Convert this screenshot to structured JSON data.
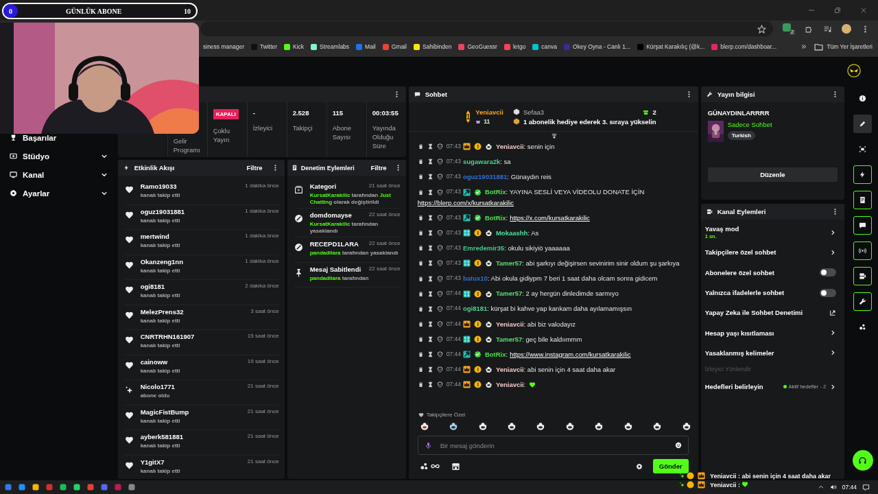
{
  "goal_overlay": {
    "current": "0",
    "label": "GÜNLÜK ABONE",
    "target": "10"
  },
  "browser": {
    "extension_badge": "2",
    "bookmarks": [
      {
        "label": "siness manager"
      },
      {
        "label": "Twitter",
        "color": "#111111"
      },
      {
        "label": "Kick",
        "color": "#53fc18"
      },
      {
        "label": "Streamlabs",
        "color": "#80f5d2"
      },
      {
        "label": "Mail",
        "color": "#1a73e8"
      },
      {
        "label": "Gmail",
        "color": "#ea4335"
      },
      {
        "label": "Sahibinden",
        "color": "#ffe800"
      },
      {
        "label": "GeoGuessr",
        "color": "#e94560"
      },
      {
        "label": "letgo",
        "color": "#ff3f55"
      },
      {
        "label": "canva",
        "color": "#00c4cc"
      },
      {
        "label": "Okey Oyna - Canlı 1...",
        "color": "#3b2b8f"
      },
      {
        "label": "Kürşat Karakılıç (@k...",
        "color": "#000000"
      },
      {
        "label": "blerp.com/dashboar...",
        "color": "#e8265e"
      }
    ],
    "all_bookmarks": "Tüm Yer İşaretleri"
  },
  "sidebar": [
    {
      "label": "Başarılar",
      "expandable": false
    },
    {
      "label": "Stüdyo",
      "expandable": true
    },
    {
      "label": "Kanal",
      "expandable": true
    },
    {
      "label": "Ayarlar",
      "expandable": true
    }
  ],
  "stats": [
    {
      "kind": "text",
      "label": "Gelir Programı"
    },
    {
      "kind": "badge",
      "value": "KAPALI",
      "label": "Çoklu Yayın"
    },
    {
      "kind": "text",
      "value": "-",
      "label": "İzleyici"
    },
    {
      "kind": "text",
      "value": "2.528",
      "label": "Takipçi"
    },
    {
      "kind": "text",
      "value": "115",
      "label": "Abone Sayısı"
    },
    {
      "kind": "text",
      "value": "00:03:55",
      "label": "Yayında Olduğu Süre"
    }
  ],
  "activity": {
    "title": "Etkinlik Akışı",
    "filter": "Filtre",
    "items": [
      {
        "kind": "follow",
        "name": "Ramo19033",
        "action": "kanalı takip etti",
        "time": "1 dakika önce"
      },
      {
        "kind": "follow",
        "name": "oguz19031881",
        "action": "kanalı takip etti",
        "time": "1 dakika önce"
      },
      {
        "kind": "follow",
        "name": "mertwind",
        "action": "kanalı takip etti",
        "time": "1 dakika önce"
      },
      {
        "kind": "follow",
        "name": "Okanzeng1nn",
        "action": "kanalı takip etti",
        "time": "1 dakika önce"
      },
      {
        "kind": "follow",
        "name": "ogi8181",
        "action": "kanalı takip etti",
        "time": "2 dakika önce"
      },
      {
        "kind": "follow",
        "name": "MelezPrens32",
        "action": "kanalı takip etti",
        "time": "3 saat önce"
      },
      {
        "kind": "follow",
        "name": "CNRTRHN161907",
        "action": "kanalı takip etti",
        "time": "15 saat önce"
      },
      {
        "kind": "follow",
        "name": "cainoww",
        "action": "kanalı takip etti",
        "time": "19 saat önce"
      },
      {
        "kind": "subscribe",
        "name": "Nicolo1771",
        "action": "abone oldu",
        "time": "21 saat önce"
      },
      {
        "kind": "follow",
        "name": "MagicFistBump",
        "action": "kanalı takip etti",
        "time": "21 saat önce"
      },
      {
        "kind": "follow",
        "name": "ayberk581881",
        "action": "kanalı takip etti",
        "time": "21 saat önce"
      },
      {
        "kind": "follow",
        "name": "Y1gitX7",
        "action": "kanalı takip etti",
        "time": "21 saat önce"
      }
    ]
  },
  "moderation": {
    "title": "Denetim Eylemleri",
    "filter": "Filtre",
    "items": [
      {
        "kind": "category",
        "title": "Kategori",
        "time": "21 saat önce",
        "parts": [
          {
            "text": "KursatKarakilic",
            "highlight": true
          },
          {
            "text": " tarafından ",
            "highlight": false
          },
          {
            "text": "Just Chatting",
            "highlight": true
          },
          {
            "text": " olarak değiştirildi",
            "highlight": false
          }
        ]
      },
      {
        "kind": "ban",
        "title": "domdomayse",
        "time": "22 saat önce",
        "parts": [
          {
            "text": "KursatKarakilic",
            "highlight": true
          },
          {
            "text": " tarafından yasaklandı",
            "highlight": false
          }
        ]
      },
      {
        "kind": "ban",
        "title": "RECEPD1LARA",
        "time": "22 saat önce",
        "parts": [
          {
            "text": "pandadilara",
            "highlight": true
          },
          {
            "text": " tarafından yasaklandı",
            "highlight": false
          }
        ]
      },
      {
        "kind": "pin",
        "title": "Mesaj Sabitlendi",
        "time": "22 saat önce",
        "parts": [
          {
            "text": "pandadilara",
            "highlight": true
          },
          {
            "text": " tarafından",
            "highlight": false
          }
        ]
      }
    ]
  },
  "chat": {
    "title": "Sohbet",
    "leaderboard": {
      "first_rank": "1",
      "first_name": "Yeniavcii",
      "first_count": "11",
      "second_name": "Sefaa3",
      "gift_count": "2",
      "prompt": "1 abonelik hediye ederek 3. sıraya yükselin"
    },
    "messages": [
      {
        "kind": "crown",
        "time": "07:43",
        "user": "Yeniavcii",
        "color": "#f0c8c8",
        "text": ": senin için"
      },
      {
        "kind": "plain",
        "time": "07:43",
        "user": "sugawara2k",
        "color": "#4fd08f",
        "text": ": sa"
      },
      {
        "kind": "plain",
        "time": "07:43",
        "user": "oguz19031881",
        "color": "#2f6fd1",
        "text": ": Günaydın reis"
      },
      {
        "kind": "bot",
        "time": "07:43",
        "user": "BotRix",
        "color": "#4ee14e",
        "text": ": YAYINA SESLİ VEYA VİDEOLU DONATE İÇİN",
        "link": "https://blerp.com/x/kursatkarakilic"
      },
      {
        "kind": "bot",
        "time": "07:43",
        "user": "BotRix",
        "color": "#4ee14e",
        "text": ":",
        "link": "https://x.com/kursatkarakilic"
      },
      {
        "kind": "og",
        "time": "07:43",
        "user": "Mokaashh",
        "color": "#4fe0a2",
        "text": ": As"
      },
      {
        "kind": "plain",
        "time": "07:43",
        "user": "Emredemir35",
        "color": "#48c98c",
        "text": ": okulu sikiyiö yaaaaaa"
      },
      {
        "kind": "og",
        "time": "07:43",
        "user": "Tamer57",
        "color": "#55e070",
        "text": ": abi şarkıyı değişirsen sevinirim sinir oldum şu şarkıya"
      },
      {
        "kind": "plain",
        "time": "07:43",
        "user": "batux10",
        "color": "#2f6fd1",
        "text": ": Abi okula gidiypm 7 beri 1 saat daha olcam sonra gidicem"
      },
      {
        "kind": "og",
        "time": "07:44",
        "user": "Tamer57",
        "color": "#55e070",
        "text": ": 2 ay hergün dinledimde sarmıyo"
      },
      {
        "kind": "plain",
        "time": "07:44",
        "user": "ogi8181",
        "color": "#4fd08f",
        "text": ": kürşat bi kahve yap kankam daha ayılamamışsın"
      },
      {
        "kind": "crown",
        "time": "07:44",
        "user": "Yeniavcii",
        "color": "#f0c8c8",
        "text": ": abi biz valodayız"
      },
      {
        "kind": "og",
        "time": "07:44",
        "user": "Tamer57",
        "color": "#55e070",
        "text": ": geç bile kaldıımmm"
      },
      {
        "kind": "bot",
        "time": "07:44",
        "user": "BotRix",
        "color": "#4ee14e",
        "text": ":",
        "link": "https://www.instagram.com/kursatkarakilic"
      },
      {
        "kind": "crown",
        "time": "07:44",
        "user": "Yeniavcii",
        "color": "#f0c8c8",
        "text": ": abi senin için 4 saat daha akar"
      },
      {
        "kind": "crown",
        "time": "07:44",
        "user": "Yeniavcii",
        "color": "#f0c8c8",
        "text": ":",
        "emote": true
      }
    ],
    "emote_label": "Takipçilere Özel",
    "placeholder": "Bir mesaj gönderin",
    "send": "Gönder"
  },
  "stream_info": {
    "title": "Yayın bilgisi",
    "stream_title": "GÜNAYDINLARRRR",
    "category": "Sadece Sohbet",
    "tag": "Turkish",
    "edit": "Düzenle"
  },
  "channel_actions": {
    "title": "Kanal Eylemleri",
    "items": [
      {
        "kind": "link",
        "label": "Yavaş mod",
        "sub": "1 sn."
      },
      {
        "kind": "link",
        "label": "Takipçilere özel sohbet"
      },
      {
        "kind": "toggle",
        "label": "Abonelere özel sohbet",
        "on": false
      },
      {
        "kind": "toggle",
        "label": "Yalnızca ifadelerle sohbet",
        "on": false
      },
      {
        "kind": "external",
        "label": "Yapay Zeka ile Sohbet Denetimi"
      },
      {
        "kind": "link",
        "label": "Hesap yaşı kısıtlaması"
      },
      {
        "kind": "link",
        "label": "Yasaklanmış kelimeler"
      },
      {
        "kind": "section",
        "label": "İzleyici Yönlendir"
      },
      {
        "kind": "link",
        "label": "Hedefleri belirleyin",
        "status": "Aktif hedefler - 2"
      }
    ]
  },
  "rail": [
    {
      "kind": "info",
      "selected": false,
      "on": false
    },
    {
      "kind": "edit",
      "selected": true,
      "on": false
    },
    {
      "kind": "camera",
      "selected": false,
      "on": false
    },
    {
      "kind": "bolt",
      "selected": false,
      "on": true
    },
    {
      "kind": "document",
      "selected": false,
      "on": true
    },
    {
      "kind": "chat",
      "selected": false,
      "on": true
    },
    {
      "kind": "broadcast",
      "selected": false,
      "on": true
    },
    {
      "kind": "video",
      "selected": false,
      "on": true
    },
    {
      "kind": "wrench",
      "selected": false,
      "on": true
    },
    {
      "kind": "dots",
      "selected": false,
      "on": false
    }
  ],
  "chat_overlay": [
    {
      "user": "Yeniavcii",
      "text": ": abi senin için 4 saat daha akar"
    },
    {
      "user": "Yeniavcii",
      "text": ":",
      "emote": true
    }
  ],
  "taskbar": {
    "time": "07:44"
  }
}
